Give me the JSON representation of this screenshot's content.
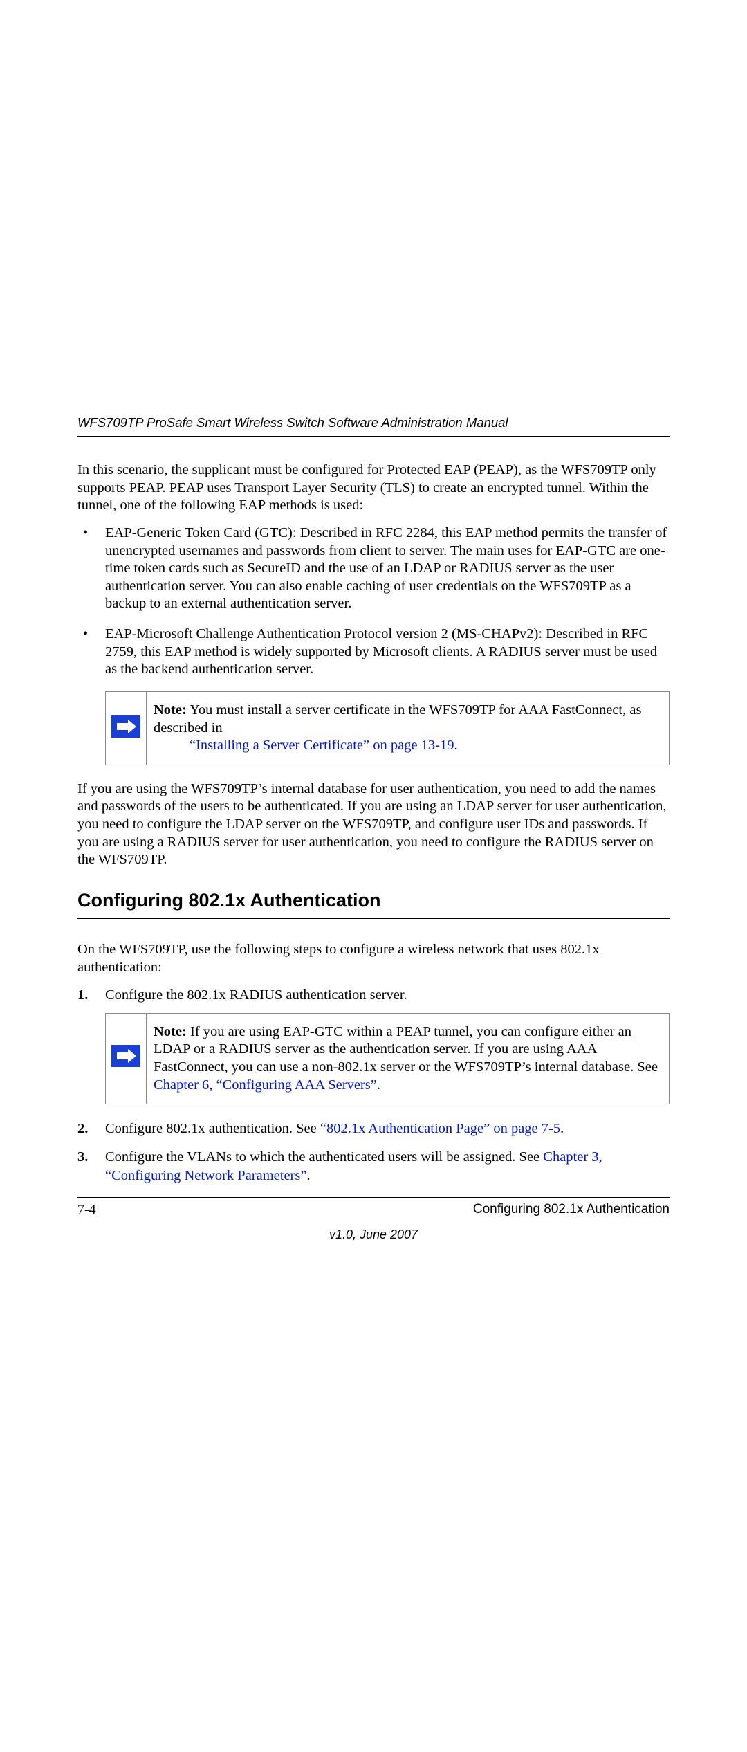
{
  "header": "WFS709TP ProSafe Smart Wireless Switch Software Administration Manual",
  "intro": "In this scenario, the supplicant must be configured for Protected EAP (PEAP), as the WFS709TP only supports PEAP. PEAP uses Transport Layer Security (TLS) to create an encrypted tunnel. Within the tunnel, one of the following EAP methods is used:",
  "bullets": [
    "EAP-Generic Token Card (GTC): Described in RFC 2284, this EAP method permits the transfer of unencrypted usernames and passwords from client to server. The main uses for EAP-GTC are one-time token cards such as SecureID and the use of an LDAP or RADIUS server as the user authentication server. You can also enable caching of user credentials on the WFS709TP as a backup to an external authentication server.",
    "EAP-Microsoft Challenge Authentication Protocol version 2 (MS-CHAPv2): Described in RFC 2759, this EAP method is widely supported by Microsoft clients. A RADIUS server must be used as the backend authentication server."
  ],
  "note1": {
    "label": "Note:",
    "text_before_link": " You must install a server certificate in the WFS709TP for AAA FastConnect, as described in ",
    "link": "“Installing a Server Certificate” on page 13-19",
    "after": "."
  },
  "post_note": "If you are using the WFS709TP’s internal database for user authentication, you need to add the names and passwords of the users to be authenticated. If you are using an LDAP server for user authentication, you need to configure the LDAP server on the WFS709TP, and configure user IDs and passwords. If you are using a RADIUS server for user authentication, you need to configure the RADIUS server on the WFS709TP.",
  "section_title": "Configuring 802.1x Authentication",
  "section_intro": "On the WFS709TP, use the following steps to configure a wireless network that uses 802.1x authentication:",
  "step1": {
    "text": "Configure the 802.1x RADIUS authentication server.",
    "note_label": "Note:",
    "note_text_before": " If you are using EAP-GTC within a PEAP tunnel, you can configure either an LDAP or a RADIUS server as the authentication server. If you are using AAA FastConnect, you can use a non-802.1x server or the WFS709TP’s internal database. See ",
    "note_link": "Chapter 6, “Configuring AAA Servers”",
    "note_after": "."
  },
  "step2": {
    "before": "Configure 802.1x authentication. See ",
    "link": "“802.1x Authentication Page” on page 7-5",
    "after": "."
  },
  "step3": {
    "before": "Configure the VLANs to which the authenticated users will be assigned. See ",
    "link": "Chapter 3, “Configuring Network Parameters”",
    "after": "."
  },
  "footer": {
    "page": "7-4",
    "right": "Configuring 802.1x Authentication",
    "version": "v1.0, June 2007"
  }
}
